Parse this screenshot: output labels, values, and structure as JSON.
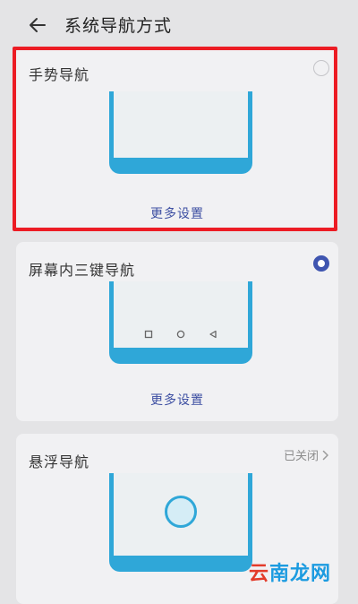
{
  "header": {
    "title": "系统导航方式"
  },
  "options": [
    {
      "label": "手势导航",
      "selected": false,
      "more_label": "更多设置"
    },
    {
      "label": "屏幕内三键导航",
      "selected": true,
      "more_label": "更多设置"
    },
    {
      "label": "悬浮导航",
      "status": "已关闭"
    }
  ],
  "watermark": {
    "text_a": "云",
    "text_b": "南龙网"
  },
  "colors": {
    "accent": "#3f55b0",
    "phone_frame": "#2fa7d8",
    "highlight": "#ec1c24"
  }
}
